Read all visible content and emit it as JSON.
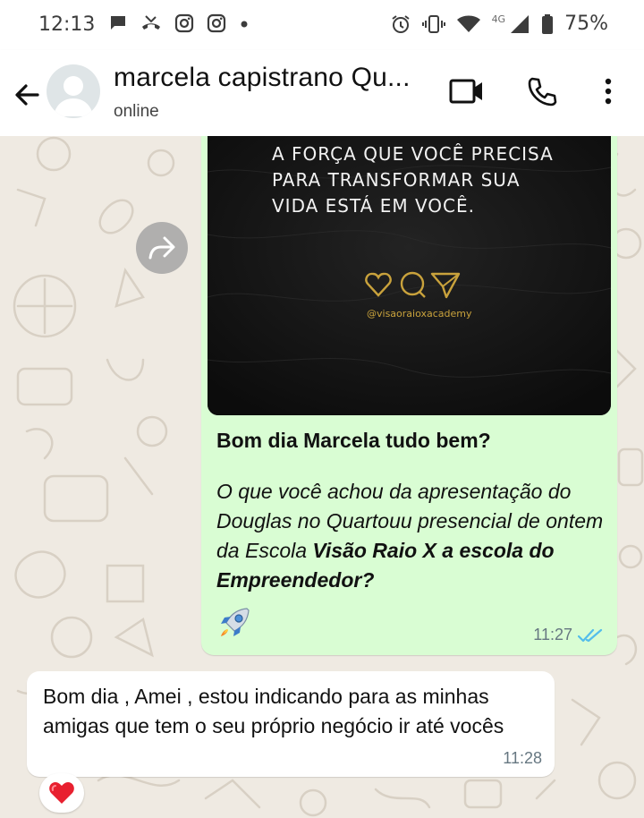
{
  "status_bar": {
    "time": "12:13",
    "network": "4G",
    "battery": "75%",
    "icons": [
      "message-bubble-icon",
      "missed-call-icon",
      "instagram-icon",
      "instagram-icon",
      "dot-icon",
      "alarm-icon",
      "vibrate-icon",
      "wifi-icon",
      "signal-icon",
      "battery-icon"
    ]
  },
  "header": {
    "contact_name": "marcela capistrano Qu...",
    "status": "online",
    "icons": [
      "back-arrow-icon",
      "avatar-placeholder",
      "video-call-icon",
      "phone-call-icon",
      "more-vert-icon"
    ]
  },
  "chat": {
    "outgoing": {
      "image_quote": "A FORÇA QUE VOCÊ PRECISA PARA TRANSFORMAR SUA VIDA ESTÁ EM VOCÊ.",
      "image_handle": "@visaoraioxacademy",
      "greeting": "Bom dia Marcela tudo bem?",
      "question_prefix": " O que você achou da apresentação do Douglas no Quartouu presencial de ontem da Escola ",
      "question_bold": "Visão Raio X a escola do Empreendedor?",
      "emoji": "rocket",
      "time": "11:27",
      "read_status": "read",
      "tick_color": "#53bdeb"
    },
    "incoming": {
      "text": "Bom dia , Amei , estou indicando para as minhas amigas que tem o seu próprio negócio ir até vocês",
      "time": "11:28",
      "reaction": "heart"
    }
  },
  "colors": {
    "chat_background": "#efeae2",
    "outgoing_bubble": "#d9fdd3",
    "incoming_bubble": "#ffffff",
    "logo_gold": "#c9a23c",
    "header_background": "#ffffff"
  }
}
